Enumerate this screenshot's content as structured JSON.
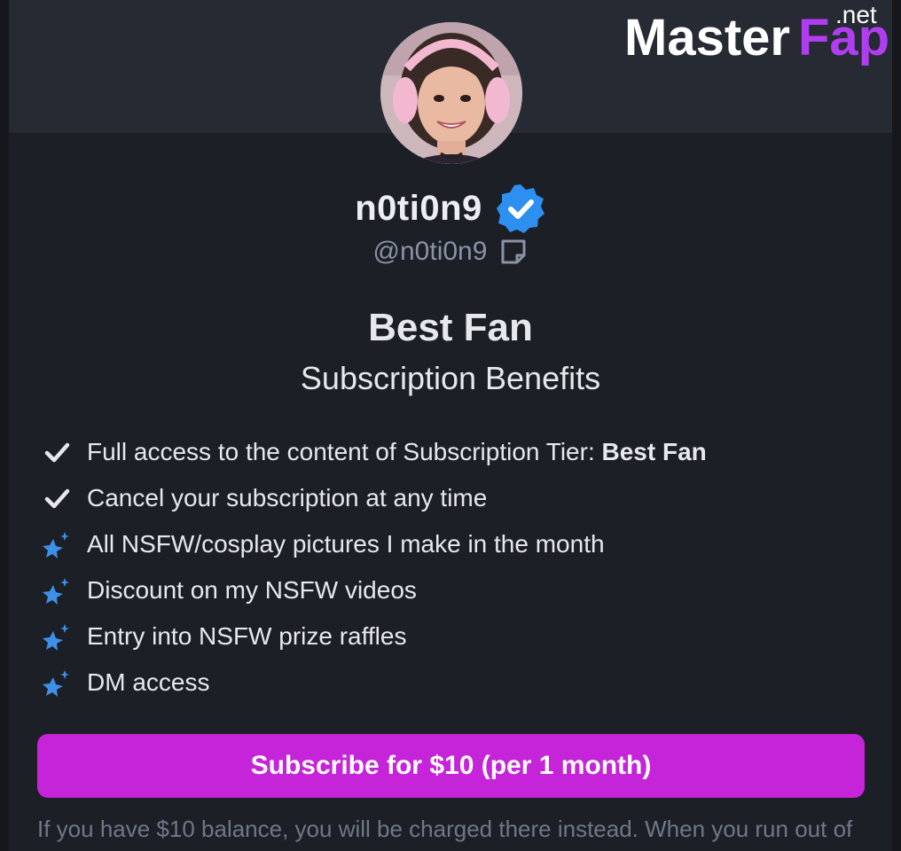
{
  "watermark": {
    "brand_a": "Master",
    "brand_b": "Fap",
    "suffix": ".net"
  },
  "profile": {
    "display_name": "n0ti0n9",
    "handle": "@n0ti0n9",
    "verified": true,
    "avatar_icon": "user-avatar-photo"
  },
  "tier": {
    "title": "Best Fan",
    "subtitle": "Subscription Benefits"
  },
  "benefits": [
    {
      "icon": "checkmark-icon",
      "text": "Full access to the content of Subscription Tier: ",
      "bold": "Best Fan"
    },
    {
      "icon": "checkmark-icon",
      "text": "Cancel your subscription at any time"
    },
    {
      "icon": "sparkle-star-icon",
      "text": "All NSFW/cosplay pictures I make in the month"
    },
    {
      "icon": "sparkle-star-icon",
      "text": "Discount on my NSFW videos"
    },
    {
      "icon": "sparkle-star-icon",
      "text": "Entry into NSFW prize raffles"
    },
    {
      "icon": "sparkle-star-icon",
      "text": "DM access"
    }
  ],
  "subscribe_button": {
    "label": "Subscribe for $10 (per 1 month)"
  },
  "note": "If you have $10 balance, you will be charged there instead. When you run out of",
  "colors": {
    "background": "#1c1f26",
    "banner": "#262a33",
    "accent": "#c524d9",
    "verified_badge": "#2d8ff0",
    "sparkle": "#3d8fe8",
    "muted_text": "#8a93a6"
  }
}
